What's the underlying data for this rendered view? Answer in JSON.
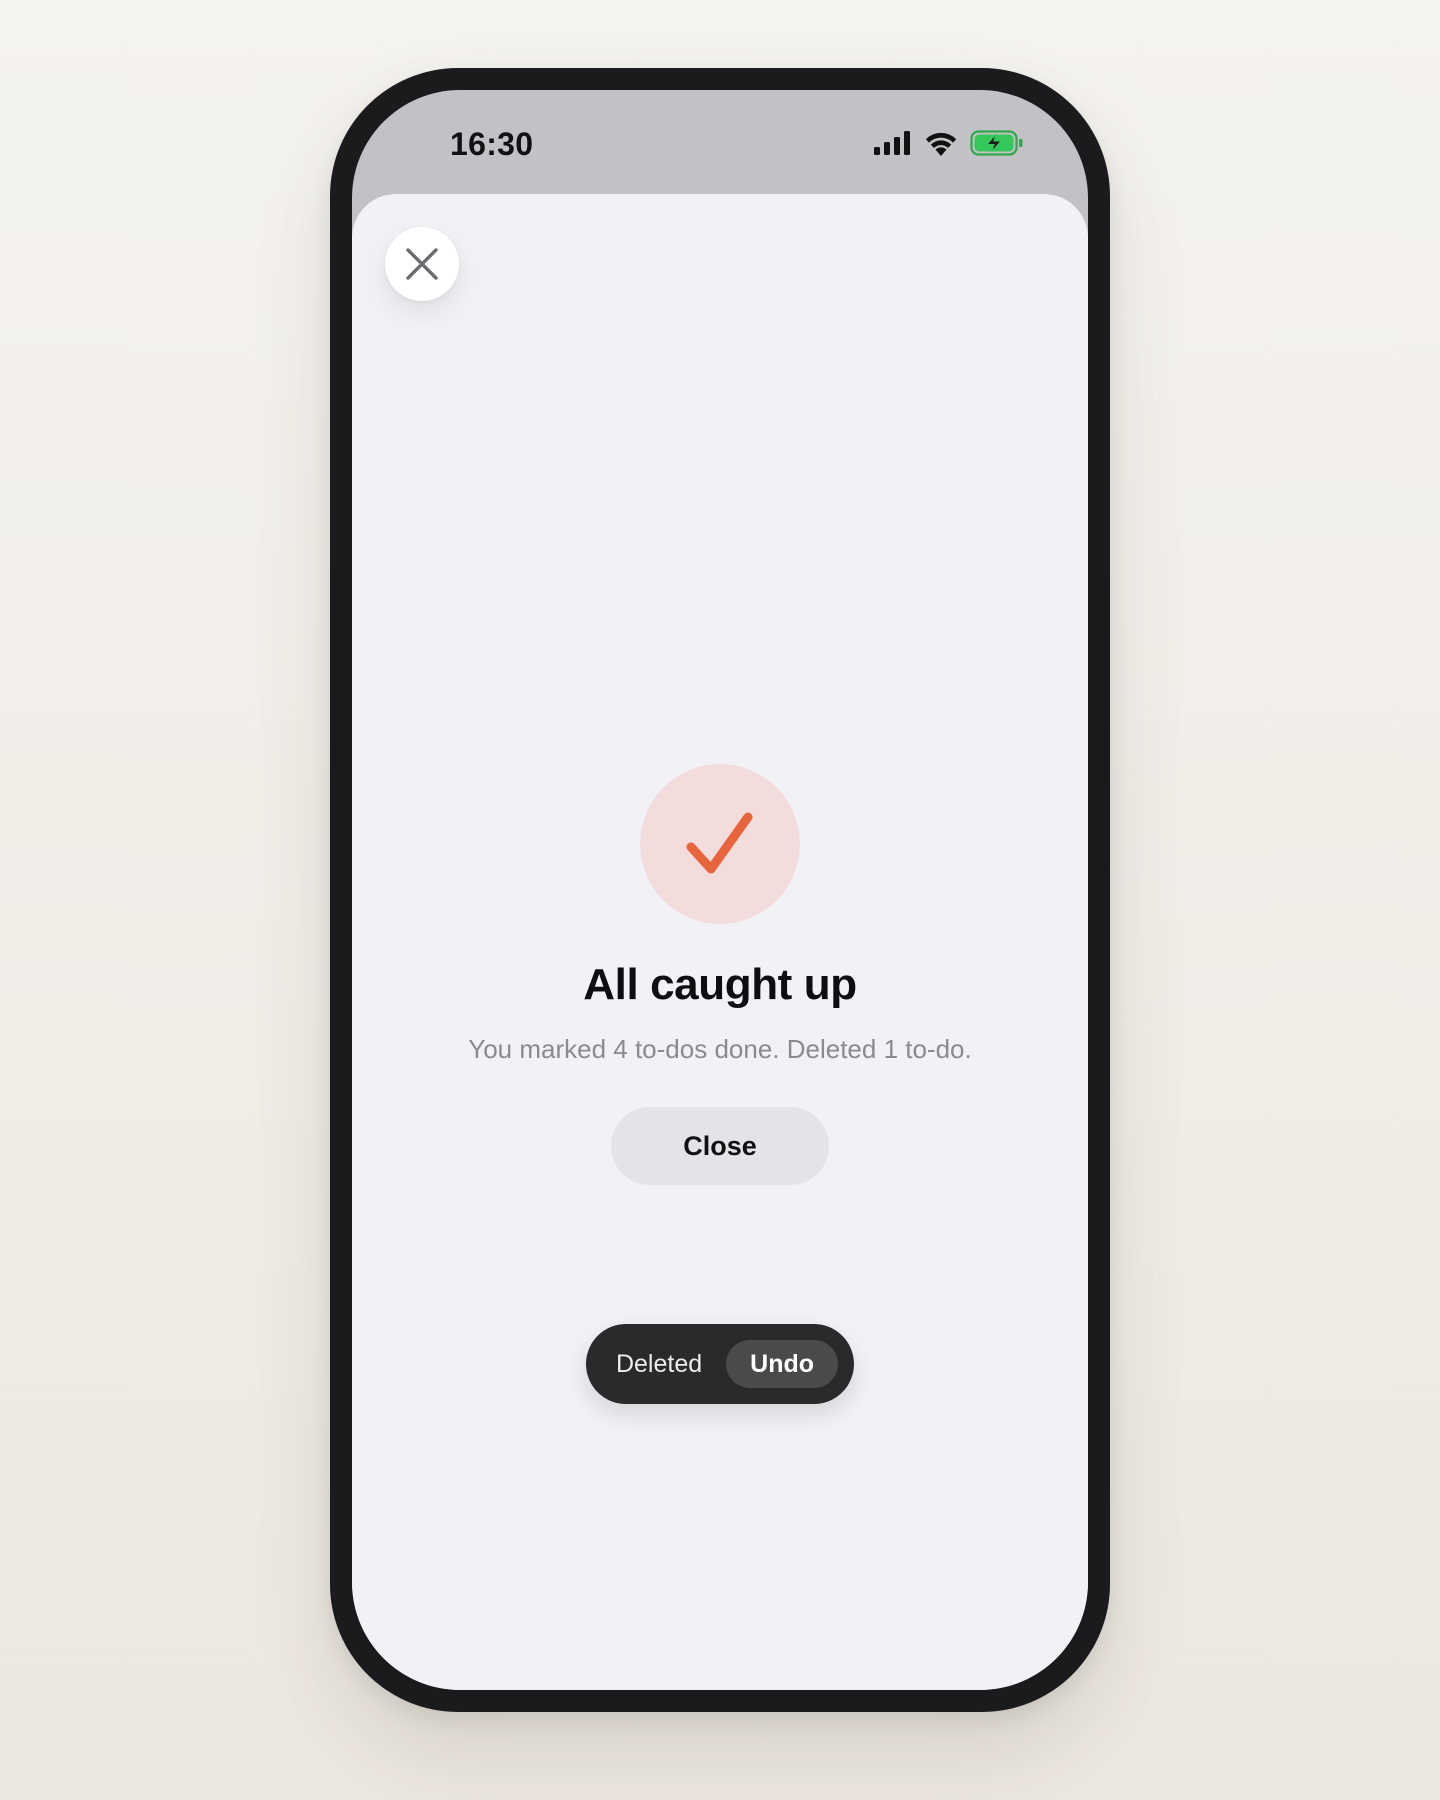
{
  "status_bar": {
    "time": "16:30",
    "icons": [
      "cellular-signal-icon",
      "wifi-icon",
      "battery-charging-icon"
    ]
  },
  "sheet": {
    "dismiss_icon": "close-icon",
    "badge_icon": "checkmark-icon",
    "title": "All caught up",
    "subtitle": "You marked 4 to-dos done. Deleted 1 to-do.",
    "close_label": "Close"
  },
  "toast": {
    "message": "Deleted",
    "action_label": "Undo"
  },
  "colors": {
    "accent": "#e8643c",
    "badge_background": "#f3dcdc",
    "sheet_background": "#f2f2f6",
    "toast_background": "#2a2a2c",
    "battery_green": "#34c759"
  }
}
